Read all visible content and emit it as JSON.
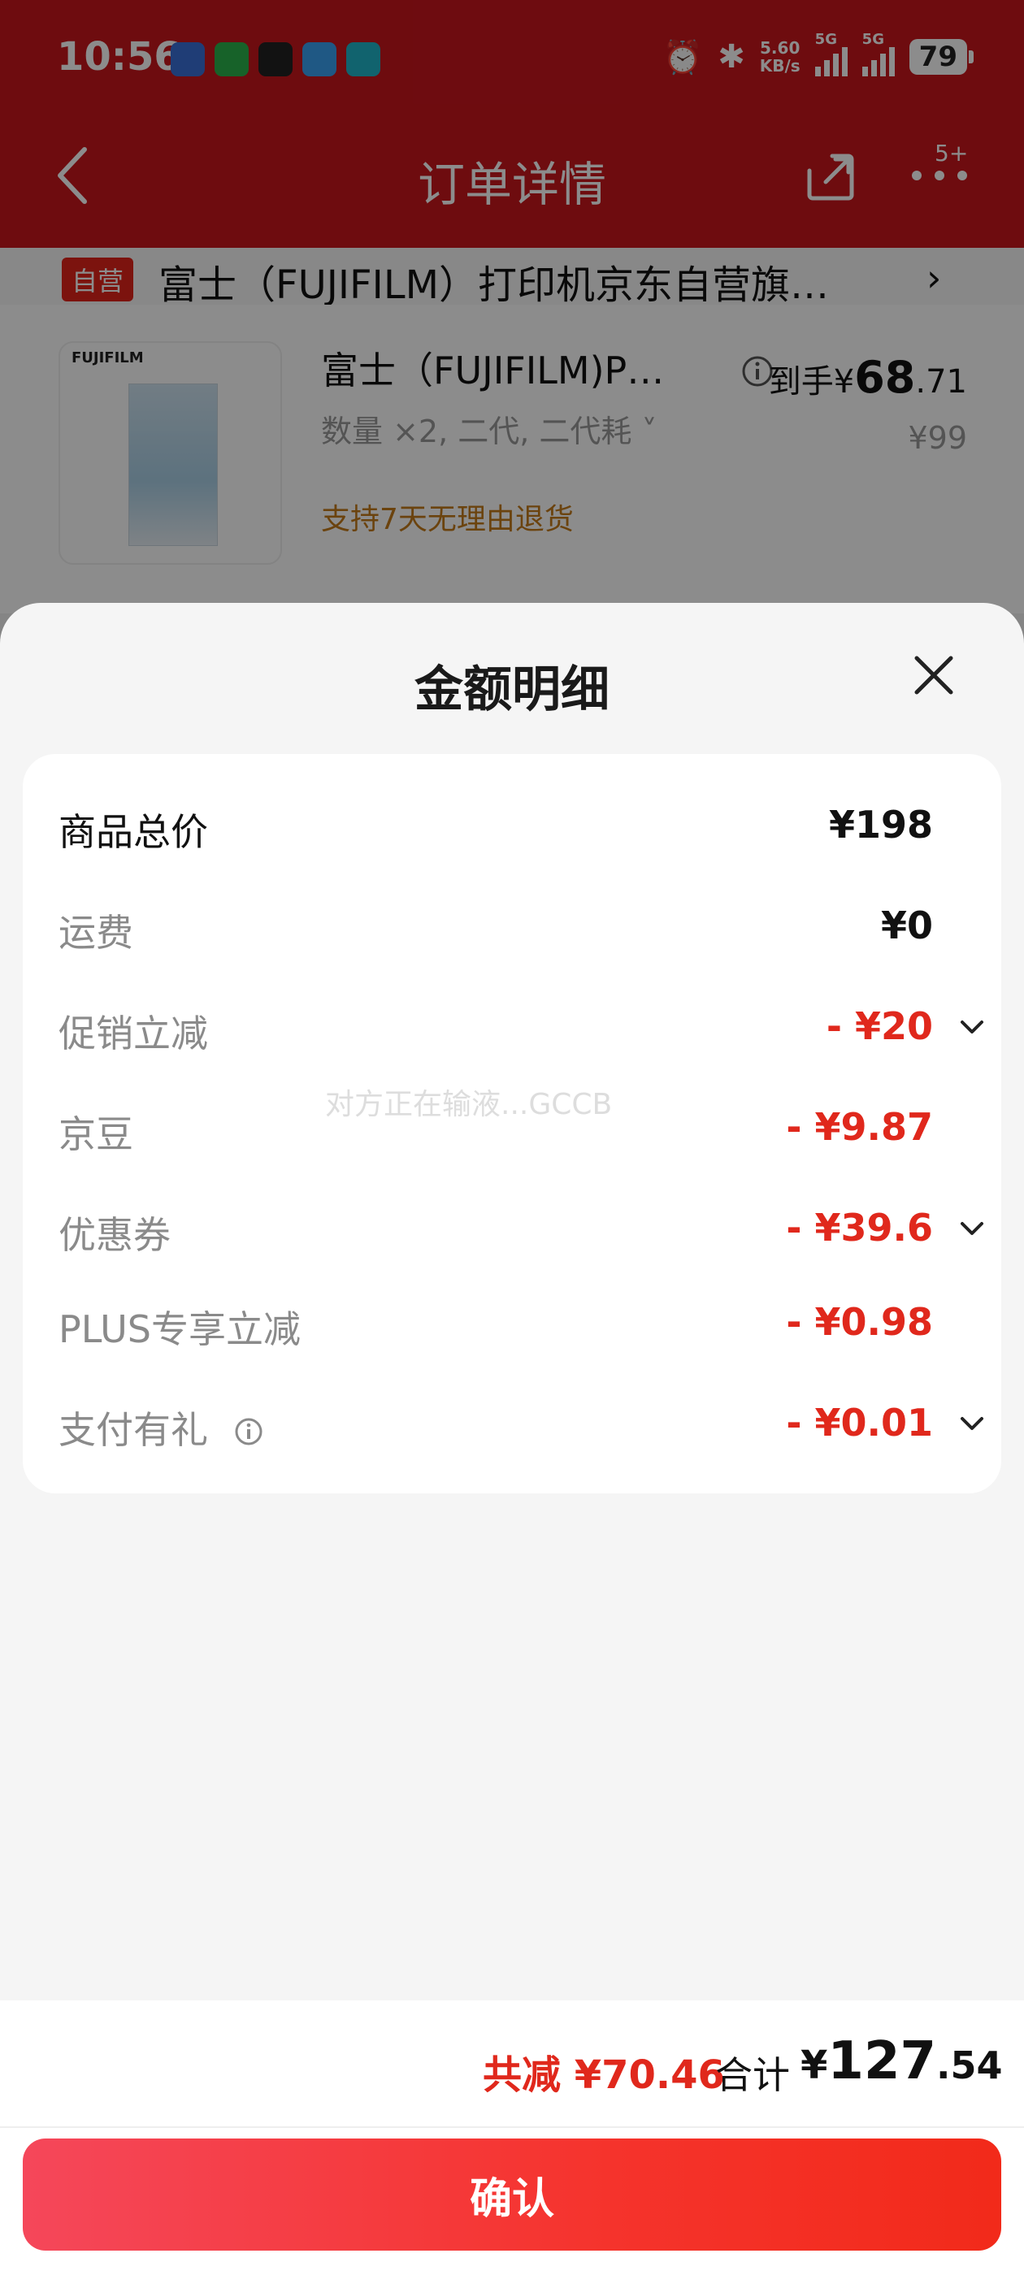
{
  "status_bar": {
    "time": "10:56",
    "net_speed_value": "5.60",
    "net_speed_unit": "KB/s",
    "network_1": "5G",
    "network_2": "5G",
    "battery": "79"
  },
  "nav": {
    "title": "订单详情",
    "badge": "5+"
  },
  "shop": {
    "tag": "自营",
    "name": "富士（FUJIFILM）打印机京东自营旗…"
  },
  "product": {
    "thumb_brand": "FUJIFILM",
    "name": "富士（FUJIFILM)P…",
    "spec": "数量 ×2, 二代, 二代耗 ˅",
    "return_policy": "支持7天无理由退货",
    "final_label": "到手",
    "final_currency": "¥",
    "final_int": "68",
    "final_dec": ".71",
    "original_price": "¥99"
  },
  "sheet": {
    "title": "金额明细",
    "rows": [
      {
        "label": "商品总价",
        "value": "¥198"
      },
      {
        "label": "运费",
        "value": "¥0"
      },
      {
        "label": "促销立减",
        "value": "- ¥20"
      },
      {
        "label": "京豆",
        "value": "- ¥9.87"
      },
      {
        "label": "优惠券",
        "value": "- ¥39.6"
      },
      {
        "label": "PLUS专享立减",
        "value": "- ¥0.98"
      },
      {
        "label": "支付有礼",
        "value": "- ¥0.01"
      }
    ],
    "watermark": "对方正在输液...GCCB"
  },
  "footer": {
    "reduce_text": "共减 ¥70.46",
    "total_label": "合计",
    "total_currency": "¥",
    "total_int": "127",
    "total_dec": ".54",
    "confirm_label": "确认"
  },
  "colors": {
    "brand_red": "#c8161d",
    "discount_red": "#e0281c",
    "button_gradient_start": "#f5475a",
    "button_gradient_end": "#f22a1a"
  }
}
